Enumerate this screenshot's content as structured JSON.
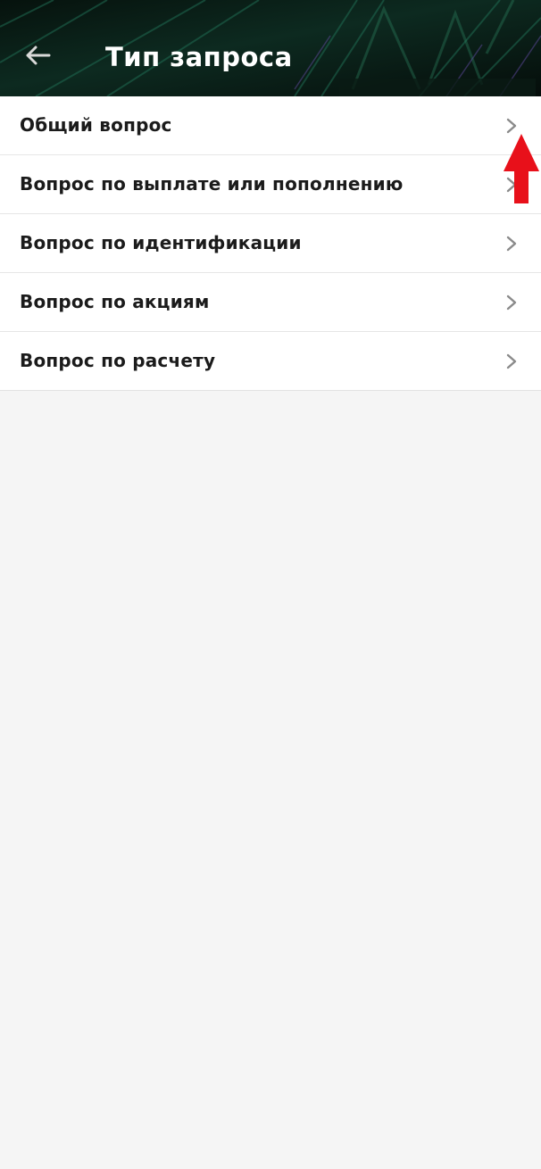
{
  "header": {
    "title": "Тип запроса",
    "back_icon": "arrow-left-icon"
  },
  "request_types": [
    {
      "label": "Общий вопрос",
      "icon": "chevron-right-icon"
    },
    {
      "label": "Вопрос по выплате или пополнению",
      "icon": "chevron-right-icon"
    },
    {
      "label": "Вопрос по идентификации",
      "icon": "chevron-right-icon"
    },
    {
      "label": "Вопрос по акциям",
      "icon": "chevron-right-icon"
    },
    {
      "label": "Вопрос по расчету",
      "icon": "chevron-right-icon"
    }
  ],
  "annotation": {
    "icon": "arrow-up-icon",
    "color": "#e8101a"
  },
  "colors": {
    "header_background": "#07160f",
    "header_accent": "#1f6b52",
    "list_background": "#ffffff",
    "page_background": "#f5f5f5",
    "text": "#1b1b1b",
    "chevron": "#8a8a8a"
  }
}
